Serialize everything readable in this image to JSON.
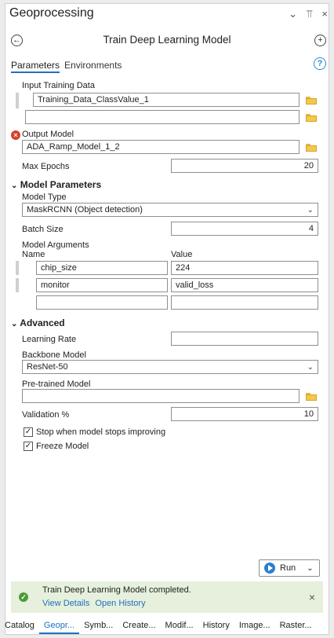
{
  "header": {
    "title": "Geoprocessing",
    "ctrl_dropdown": "⌄",
    "ctrl_pin": "⫪",
    "ctrl_close": "×"
  },
  "tool": {
    "title": "Train Deep Learning Model"
  },
  "tabs": {
    "parameters": "Parameters",
    "environments": "Environments"
  },
  "help": "?",
  "input_training_data": {
    "label": "Input Training Data",
    "value": "Training_Data_ClassValue_1",
    "empty_value": ""
  },
  "output_model": {
    "label": "Output Model",
    "value": "ADA_Ramp_Model_1_2"
  },
  "max_epochs": {
    "label": "Max Epochs",
    "value": "20"
  },
  "model_parameters": {
    "heading": "Model Parameters",
    "model_type_label": "Model Type",
    "model_type_value": "MaskRCNN (Object detection)",
    "batch_size_label": "Batch Size",
    "batch_size_value": "4",
    "model_arguments_label": "Model Arguments",
    "col_name": "Name",
    "col_value": "Value",
    "rows": [
      {
        "name": "chip_size",
        "value": "224"
      },
      {
        "name": "monitor",
        "value": "valid_loss"
      },
      {
        "name": "",
        "value": ""
      }
    ]
  },
  "advanced": {
    "heading": "Advanced",
    "learning_rate_label": "Learning Rate",
    "learning_rate_value": "",
    "backbone_label": "Backbone Model",
    "backbone_value": "ResNet-50",
    "pretrained_label": "Pre-trained Model",
    "pretrained_value": "",
    "validation_label": "Validation %",
    "validation_value": "10",
    "stop_label": "Stop when model stops improving",
    "freeze_label": "Freeze Model"
  },
  "run": {
    "label": "Run"
  },
  "status": {
    "message": "Train Deep Learning Model completed.",
    "view_details": "View Details",
    "open_history": "Open History"
  },
  "bottom_tabs": [
    "Catalog",
    "Geopr...",
    "Symb...",
    "Create...",
    "Modif...",
    "History",
    "Image...",
    "Raster..."
  ],
  "colors": {
    "accent": "#1f6fc1",
    "error": "#d9412c",
    "success_bg": "#e6f0dc",
    "success_icon": "#4a9a3a",
    "folder": "#f2c94c"
  }
}
